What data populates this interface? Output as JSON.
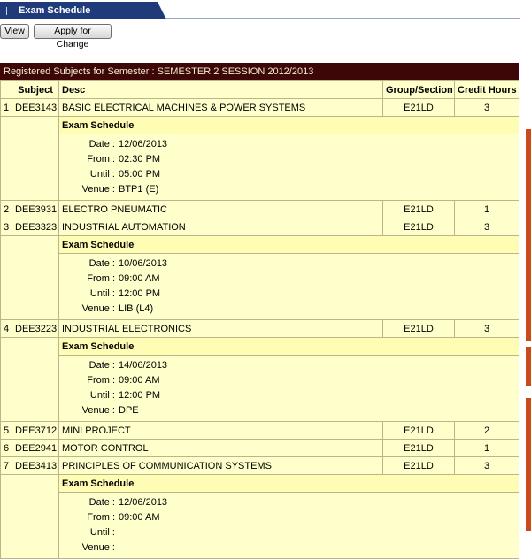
{
  "page": {
    "title": "Exam Schedule",
    "buttons": {
      "view": "View",
      "apply": "Apply for Change"
    }
  },
  "table": {
    "banner": "Registered Subjects for Semester : SEMESTER 2 SESSION 2012/2013",
    "headers": {
      "subject": "Subject",
      "desc": "Desc",
      "group": "Group/Section",
      "credit": "Credit Hours"
    },
    "schedule_heading": "Exam Schedule",
    "labels": {
      "date": "Date :",
      "from": "From :",
      "until": "Until :",
      "venue": "Venue :"
    },
    "rows": [
      {
        "no": "1",
        "subject": "DEE3143",
        "desc": "BASIC ELECTRICAL MACHINES & POWER SYSTEMS",
        "group": "E21LD",
        "credit": "3",
        "exam": {
          "date": "12/06/2013",
          "from": "02:30 PM",
          "until": "05:00 PM",
          "venue": "BTP1 (E)"
        }
      },
      {
        "no": "2",
        "subject": "DEE3931",
        "desc": "ELECTRO PNEUMATIC",
        "group": "E21LD",
        "credit": "1"
      },
      {
        "no": "3",
        "subject": "DEE3323",
        "desc": "INDUSTRIAL AUTOMATION",
        "group": "E21LD",
        "credit": "3",
        "exam": {
          "date": "10/06/2013",
          "from": "09:00 AM",
          "until": "12:00 PM",
          "venue": "LIB (L4)"
        }
      },
      {
        "no": "4",
        "subject": "DEE3223",
        "desc": "INDUSTRIAL ELECTRONICS",
        "group": "E21LD",
        "credit": "3",
        "exam": {
          "date": "14/06/2013",
          "from": "09:00 AM",
          "until": "12:00 PM",
          "venue": "DPE"
        }
      },
      {
        "no": "5",
        "subject": "DEE3712",
        "desc": "MINI PROJECT",
        "group": "E21LD",
        "credit": "2"
      },
      {
        "no": "6",
        "subject": "DEE2941",
        "desc": "MOTOR CONTROL",
        "group": "E21LD",
        "credit": "1"
      },
      {
        "no": "7",
        "subject": "DEE3413",
        "desc": "PRINCIPLES OF COMMUNICATION SYSTEMS",
        "group": "E21LD",
        "credit": "3",
        "exam": {
          "date": "12/06/2013",
          "from": "09:00 AM",
          "until": "",
          "venue": ""
        }
      }
    ]
  },
  "colors": {
    "tab": "#1f3b7a",
    "banner": "#3d0707",
    "cell": "#ffffcc",
    "side_accent": "#c94a1a"
  },
  "icons": {
    "tab": "crosshair-icon"
  }
}
